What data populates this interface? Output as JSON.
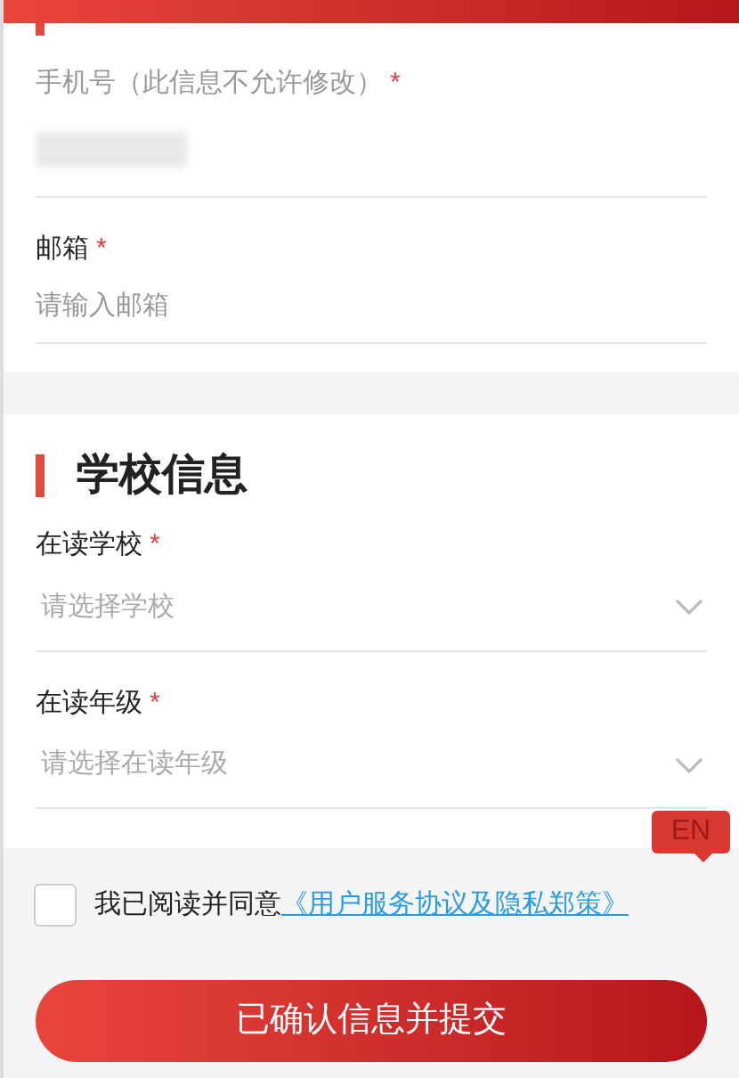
{
  "contact": {
    "phone": {
      "label": "手机号（此信息不允许修改）",
      "required_mark": "*"
    },
    "email": {
      "label": "邮箱",
      "required_mark": "*",
      "placeholder": "请输入邮箱"
    }
  },
  "school": {
    "title": "学校信息",
    "fields": [
      {
        "label": "在读学校",
        "required_mark": "*",
        "placeholder": "请选择学校"
      },
      {
        "label": "在读年级",
        "required_mark": "*",
        "placeholder": "请选择在读年级"
      }
    ]
  },
  "language_badge": "EN",
  "agreement": {
    "checked": false,
    "text": "我已阅读并同意",
    "link": "《用户服务协议及隐私郑策》"
  },
  "submit": "已确认信息并提交"
}
